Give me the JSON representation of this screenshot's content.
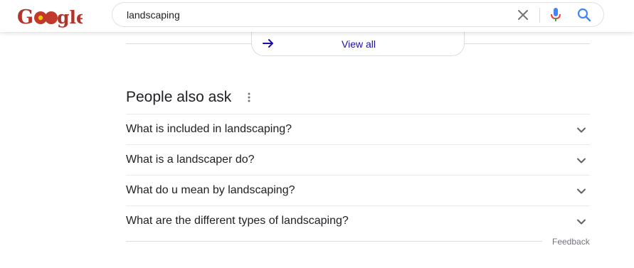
{
  "header": {
    "logo_text": "Google",
    "search_query": "landscaping",
    "icons": {
      "clear": "close-icon",
      "mic": "microphone-icon",
      "search": "search-icon"
    }
  },
  "view_all": {
    "label": "View all",
    "icon": "arrow-right-icon"
  },
  "people_also_ask": {
    "title": "People also ask",
    "questions": [
      "What is included in landscaping?",
      "What is a landscaper do?",
      "What do u mean by landscaping?",
      "What are the different types of landscaping?"
    ]
  },
  "feedback": {
    "label": "Feedback"
  },
  "colors": {
    "link": "#1a0dab",
    "text": "#202124",
    "muted": "#70757a",
    "mic_blue": "#4285f4",
    "mic_red": "#ea4335",
    "logo_red": "#b0342c"
  }
}
